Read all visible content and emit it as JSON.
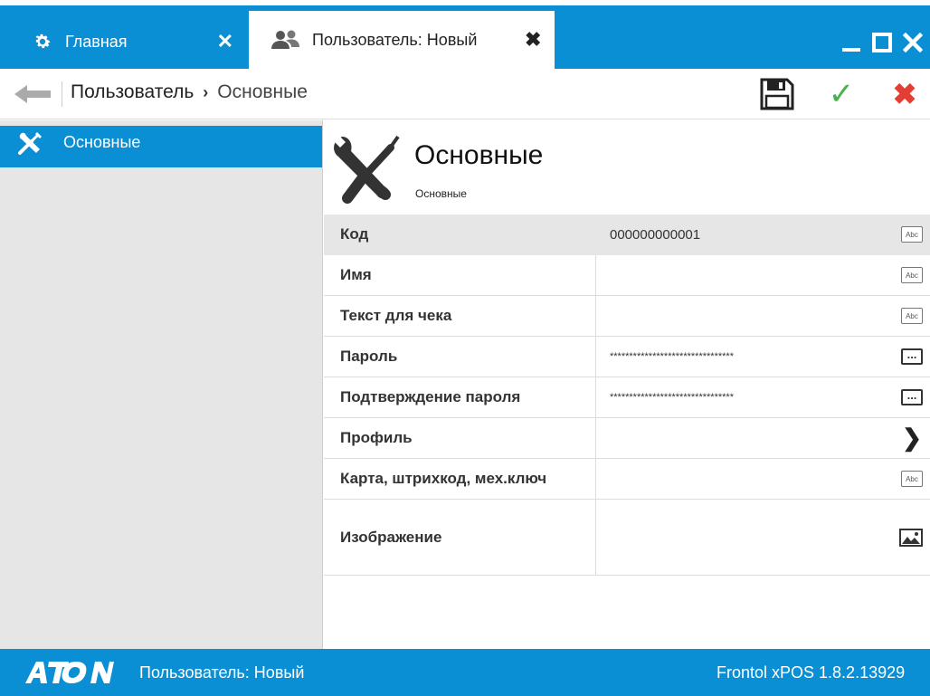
{
  "tabs": {
    "home_label": "Главная",
    "user_label": "Пользователь: Новый"
  },
  "breadcrumb": {
    "root": "Пользователь",
    "current": "Основные"
  },
  "sidebar": {
    "items": [
      {
        "label": "Основные",
        "icon": "tools-icon"
      }
    ]
  },
  "section": {
    "title": "Основные",
    "subtitle": "Основные"
  },
  "properties": [
    {
      "name": "Код",
      "value": "000000000001",
      "editor": "abc"
    },
    {
      "name": "Имя",
      "value": "",
      "editor": "abc"
    },
    {
      "name": "Текст для чека",
      "value": "",
      "editor": "abc"
    },
    {
      "name": "Пароль",
      "value": "********************************",
      "editor": "dots"
    },
    {
      "name": "Подтверждение пароля",
      "value": "********************************",
      "editor": "dots"
    },
    {
      "name": "Профиль",
      "value": "",
      "editor": "arrow"
    },
    {
      "name": "Карта, штрихкод, мех.ключ",
      "value": "",
      "editor": "abc"
    },
    {
      "name": "Изображение",
      "value": "",
      "editor": "image"
    }
  ],
  "editor_labels": {
    "abc": "Abc",
    "dots": "..."
  },
  "status": {
    "logo": "ATON",
    "left": "Пользователь: Новый",
    "right": "Frontol xPOS 1.8.2.13929"
  },
  "colors": {
    "accent": "#0a8fd4",
    "ok": "#46b24b",
    "cancel": "#e33e34",
    "sidebar_bg": "#e6e6e6"
  }
}
